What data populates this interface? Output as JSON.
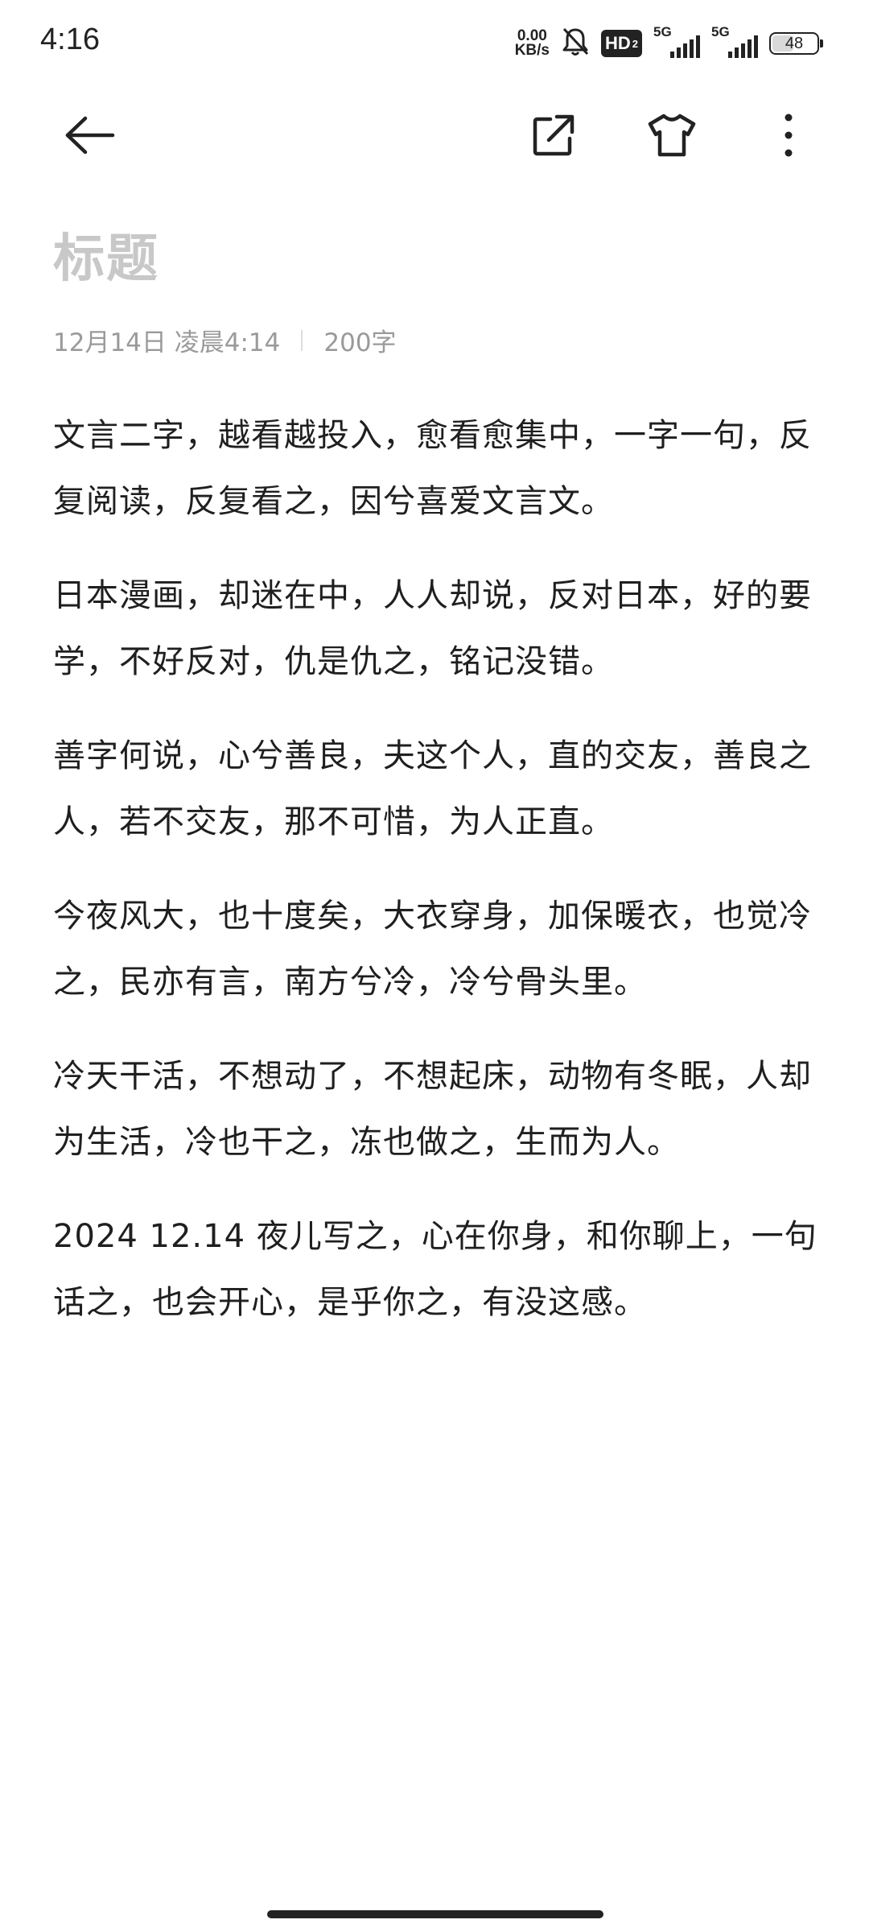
{
  "status_bar": {
    "time": "4:16",
    "net_speed_value": "0.00",
    "net_speed_unit": "KB/s",
    "hd_label": "HD",
    "hd_sub": "2",
    "signal1_tag": "5G",
    "signal2_tag": "5G",
    "battery_level": "48",
    "icons": [
      "mute-bell-icon",
      "hd-voice-icon",
      "signal-icon",
      "battery-icon"
    ]
  },
  "toolbar": {
    "icons": [
      "back-arrow-icon",
      "share-icon",
      "theme-shirt-icon",
      "more-vertical-icon"
    ]
  },
  "note": {
    "title_placeholder": "标题",
    "date": "12月14日 凌晨4:14",
    "word_count": "200字",
    "paragraphs": [
      "文言二字，越看越投入，愈看愈集中，一字一句，反复阅读，反复看之，因兮喜爱文言文。",
      "日本漫画，却迷在中，人人却说，反对日本，好的要学，不好反对，仇是仇之，铭记没错。",
      "善字何说，心兮善良，夫这个人，直的交友，善良之人，若不交友，那不可惜，为人正直。",
      "今夜风大，也十度矣，大衣穿身，加保暖衣，也觉冷之，民亦有言，南方兮冷，冷兮骨头里。",
      "冷天干活，不想动了，不想起床，动物有冬眠，人却为生活，冷也干之，冻也做之，生而为人。",
      "2024 12.14 夜儿写之，心在你身，和你聊上，一句话之，也会开心，是乎你之，有没这感。"
    ]
  },
  "colors": {
    "text": "#1f1f1f",
    "title_placeholder": "#c8c8c8",
    "meta": "#9a9a9a",
    "background": "#ffffff"
  }
}
